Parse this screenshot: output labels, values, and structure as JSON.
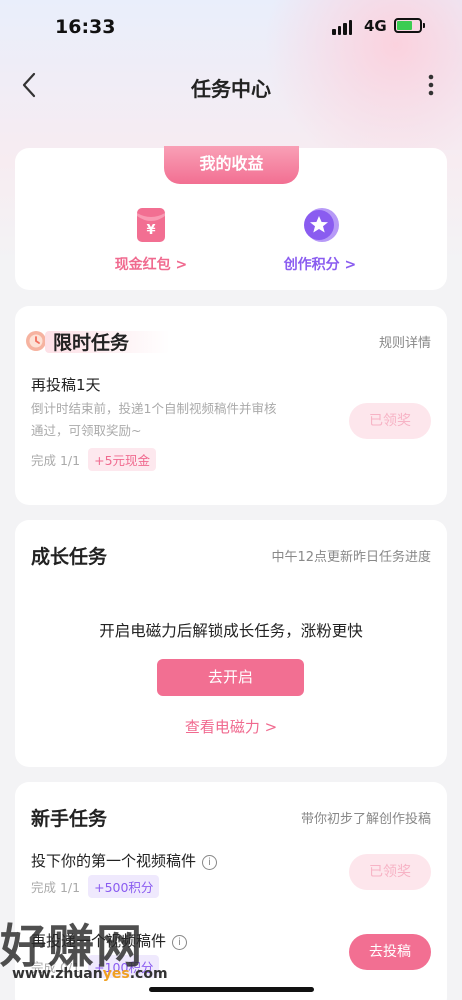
{
  "status_bar": {
    "time": "16:33",
    "network": "4G"
  },
  "nav": {
    "title": "任务中心"
  },
  "earnings": {
    "tab_label": "我的收益",
    "items": [
      {
        "label": "现金红包 >",
        "icon": "red-envelope-icon",
        "color": "#f06a8f"
      },
      {
        "label": "创作积分 >",
        "icon": "star-coin-icon",
        "color": "#8a5cf0"
      }
    ]
  },
  "limited": {
    "title": "限时任务",
    "rules_link": "规则详情",
    "task": {
      "name": "再投稿1天",
      "desc_line1": "倒计时结束前，投递1个自制视频稿件并审核",
      "desc_line2": "通过，可领取奖励~",
      "progress": "完成 1/1",
      "reward": "+5元现金",
      "button": "已领奖"
    }
  },
  "growth": {
    "title": "成长任务",
    "note": "中午12点更新昨日任务进度",
    "message": "开启电磁力后解锁成长任务，涨粉更快",
    "button": "去开启",
    "link": "查看电磁力 >"
  },
  "newbie": {
    "title": "新手任务",
    "note": "带你初步了解创作投稿",
    "tasks": [
      {
        "name": "投下你的第一个视频稿件",
        "progress": "完成 1/1",
        "reward": "+500积分",
        "button": "已领奖"
      },
      {
        "name": "再投递一个视频稿件",
        "progress": "完成 0/1",
        "reward": "+100积分",
        "button": "去投稿"
      }
    ]
  },
  "watermark": {
    "main": "好赚网",
    "sub_prefix": "www.zhuan",
    "sub_highlight": "yes",
    "sub_suffix": ".com"
  },
  "colors": {
    "accent": "#f26f92",
    "purple": "#8a5cf0"
  }
}
